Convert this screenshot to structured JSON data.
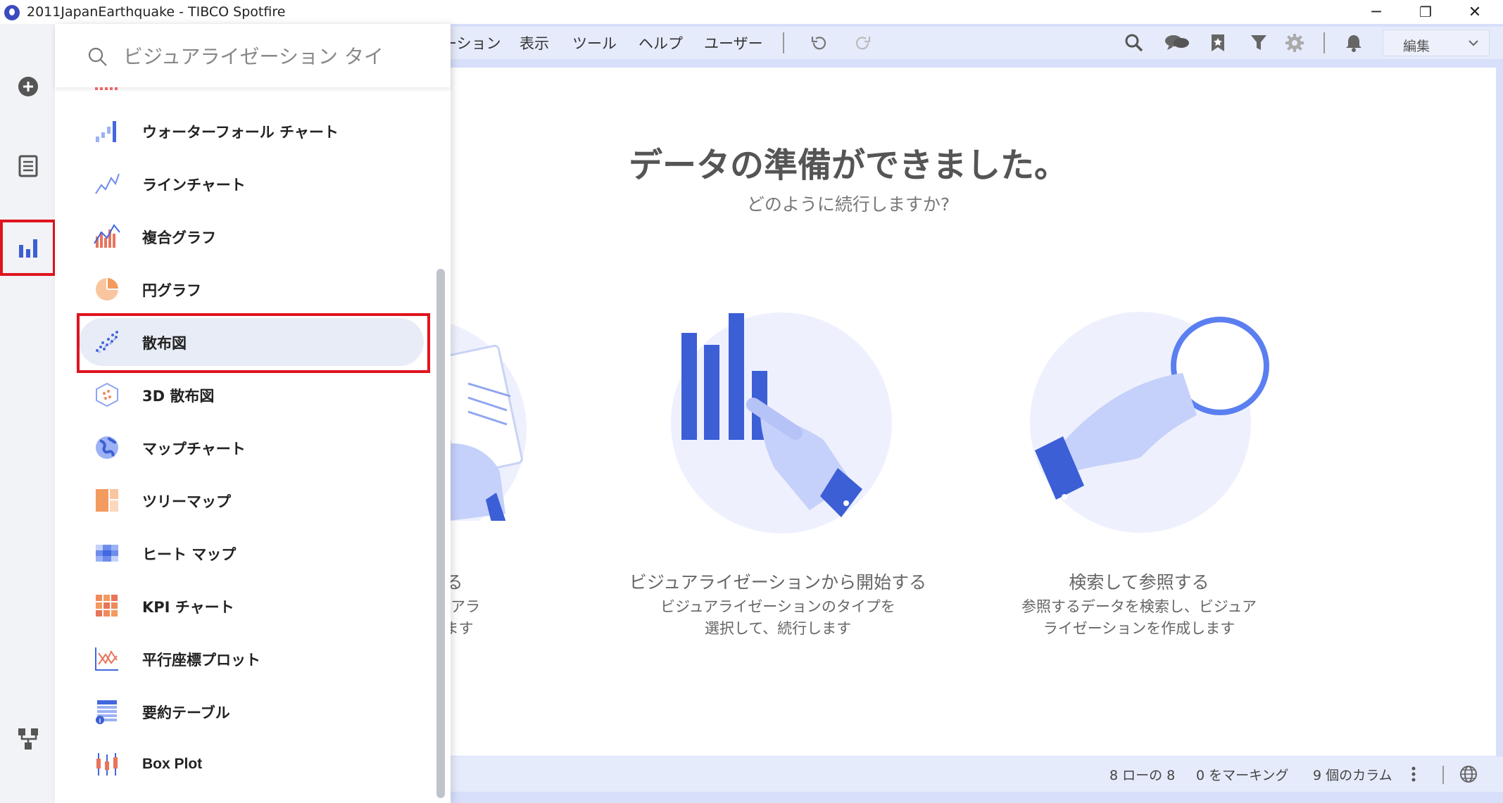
{
  "window": {
    "title": "2011JapanEarthquake - TIBCO Spotfire",
    "minimize": "─",
    "restore": "❐",
    "close": "✕"
  },
  "menu": {
    "items": [
      "ーション",
      "表示",
      "ツール",
      "ヘルプ",
      "ユーザー"
    ],
    "edit_mode": "編集"
  },
  "search": {
    "placeholder": "ビジュアライゼーション タイ"
  },
  "visualizations": [
    {
      "label": "ウォーターフォール チャート",
      "icon": "waterfall-chart-icon"
    },
    {
      "label": "ラインチャート",
      "icon": "line-chart-icon"
    },
    {
      "label": "複合グラフ",
      "icon": "combination-chart-icon"
    },
    {
      "label": "円グラフ",
      "icon": "pie-chart-icon"
    },
    {
      "label": "散布図",
      "icon": "scatter-plot-icon",
      "selected": true
    },
    {
      "label": "3D 散布図",
      "icon": "3d-scatter-plot-icon"
    },
    {
      "label": "マップチャート",
      "icon": "map-chart-icon"
    },
    {
      "label": "ツリーマップ",
      "icon": "treemap-icon"
    },
    {
      "label": "ヒート マップ",
      "icon": "heat-map-icon"
    },
    {
      "label": "KPI チャート",
      "icon": "kpi-chart-icon"
    },
    {
      "label": "平行座標プロット",
      "icon": "parallel-coordinate-plot-icon"
    },
    {
      "label": "要約テーブル",
      "icon": "summary-table-icon"
    },
    {
      "label": "Box Plot",
      "icon": "box-plot-icon"
    }
  ],
  "main": {
    "heading": "データの準備ができました。",
    "subheading": "どのように続行しますか?",
    "cards": [
      {
        "title": "始する",
        "desc1": "、ビジュアラ",
        "desc2": "表示します"
      },
      {
        "title": "ビジュアライゼーションから開始する",
        "desc1": "ビジュアライゼーションのタイプを",
        "desc2": "選択して、続行します"
      },
      {
        "title": "検索して参照する",
        "desc1": "参照するデータを検索し、ビジュア",
        "desc2": "ライゼーションを作成します"
      }
    ]
  },
  "status": {
    "rows": "8 ローの 8",
    "marking": "0 をマーキング",
    "columns": "9 個のカラム"
  },
  "colors": {
    "accent": "#3b5bdb",
    "highlight": "#e0141e",
    "toolbar": "#d7dffa"
  }
}
